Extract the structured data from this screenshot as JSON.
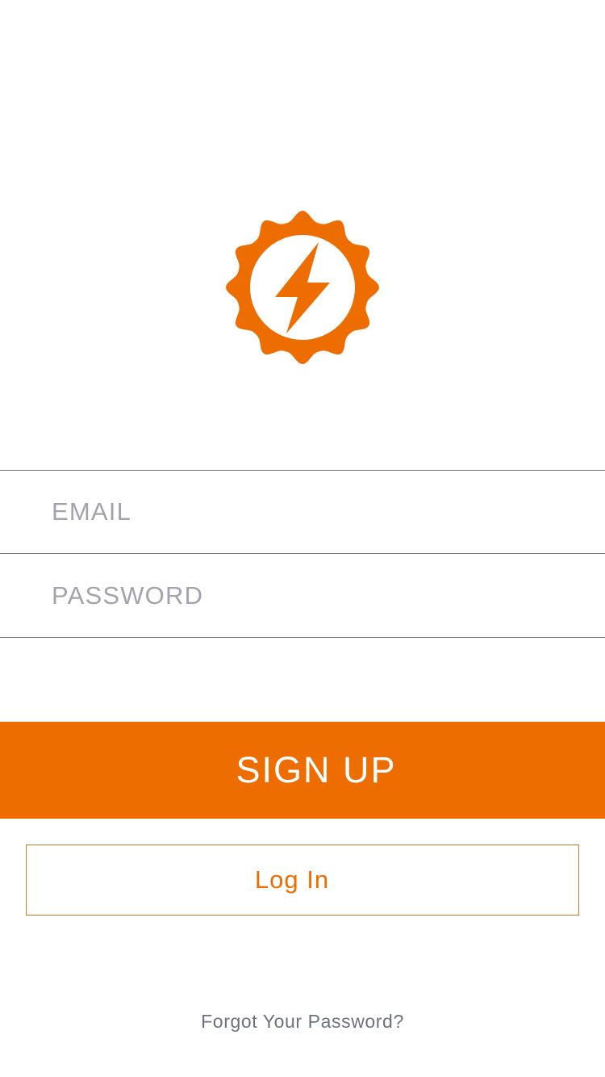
{
  "brand": {
    "logo_icon": "sun-bolt-icon",
    "accent_color": "#ee6d00"
  },
  "form": {
    "email_placeholder": "EMAIL",
    "email_value": "",
    "password_placeholder": "PASSWORD",
    "password_value": ""
  },
  "actions": {
    "signup_label": "SIGN UP",
    "login_label": "Log In",
    "forgot_label": "Forgot Your Password?"
  }
}
